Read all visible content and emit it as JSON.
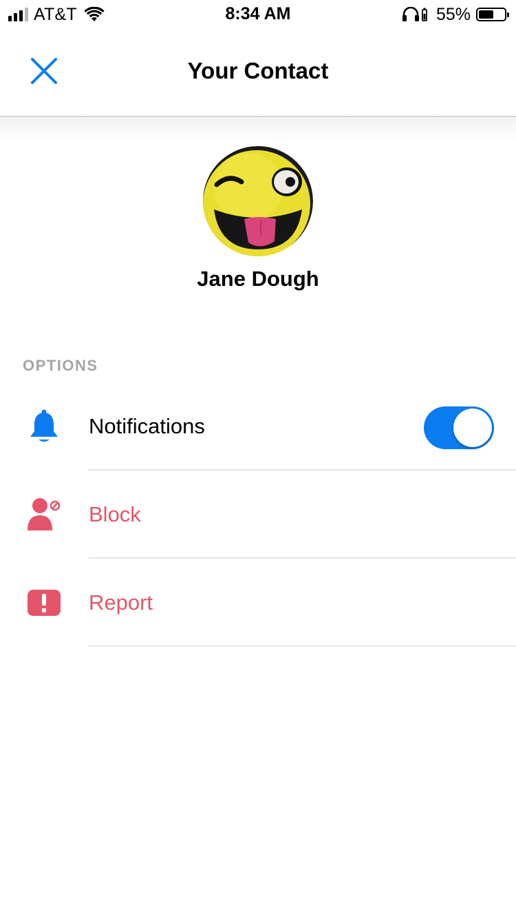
{
  "status_bar": {
    "carrier": "AT&T",
    "time": "8:34 AM",
    "battery_percent": "55%",
    "battery_level": 0.55,
    "signal_bars": 3,
    "signal_bars_total": 4,
    "icons": [
      "signal-icon",
      "wifi-icon",
      "headphones-icon",
      "battery-icon"
    ]
  },
  "nav": {
    "title": "Your Contact",
    "close_icon": "close-icon",
    "accent_color": "#0a7cf0"
  },
  "profile": {
    "name": "Jane Dough",
    "avatar": "winking-emoji-pillow-photo"
  },
  "options": {
    "header": "OPTIONS",
    "items": [
      {
        "label": "Notifications",
        "icon": "bell-icon",
        "color": "#0a7cf0",
        "toggle": true,
        "toggle_on": true
      },
      {
        "label": "Block",
        "icon": "block-user-icon",
        "color": "#e5556a"
      },
      {
        "label": "Report",
        "icon": "report-icon",
        "color": "#e5556a"
      }
    ]
  }
}
